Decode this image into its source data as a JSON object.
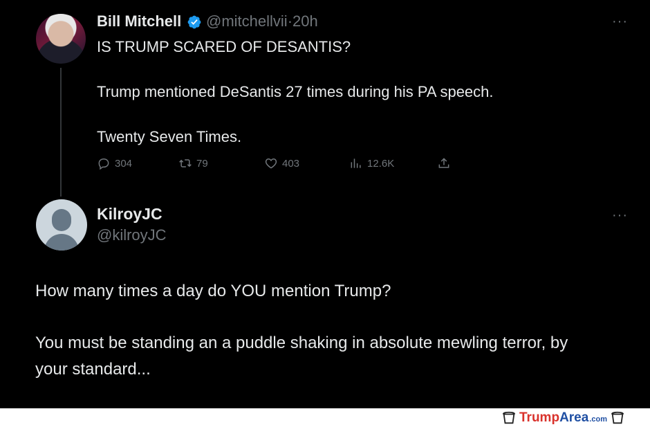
{
  "tweet1": {
    "name": "Bill Mitchell",
    "handle": "@mitchellvii",
    "separator": "·",
    "time": "20h",
    "lines": [
      "IS TRUMP SCARED OF DESANTIS?",
      "Trump mentioned DeSantis 27 times during his PA speech.",
      "Twenty Seven Times."
    ],
    "actions": {
      "replies": "304",
      "retweets": "79",
      "likes": "403",
      "views": "12.6K"
    },
    "more": "···"
  },
  "tweet2": {
    "name": "KilroyJC",
    "handle": "@kilroyJC",
    "more": "···",
    "lines": [
      "How many times a day do YOU mention Trump?",
      "You must be standing an a puddle shaking in absolute mewling terror, by",
      "your standard..."
    ]
  },
  "watermark": {
    "part1": "Trump",
    "part2": "Area",
    "part3": ".com"
  },
  "colors": {
    "background": "#000000",
    "text": "#e7e9ea",
    "muted": "#71767b",
    "verified": "#1d9bf0",
    "watermark_red": "#d9312b",
    "watermark_blue": "#1f4fa3"
  },
  "icons": [
    "reply-icon",
    "retweet-icon",
    "like-icon",
    "views-icon",
    "share-icon",
    "verified-badge-icon",
    "more-icon",
    "cup-icon"
  ]
}
